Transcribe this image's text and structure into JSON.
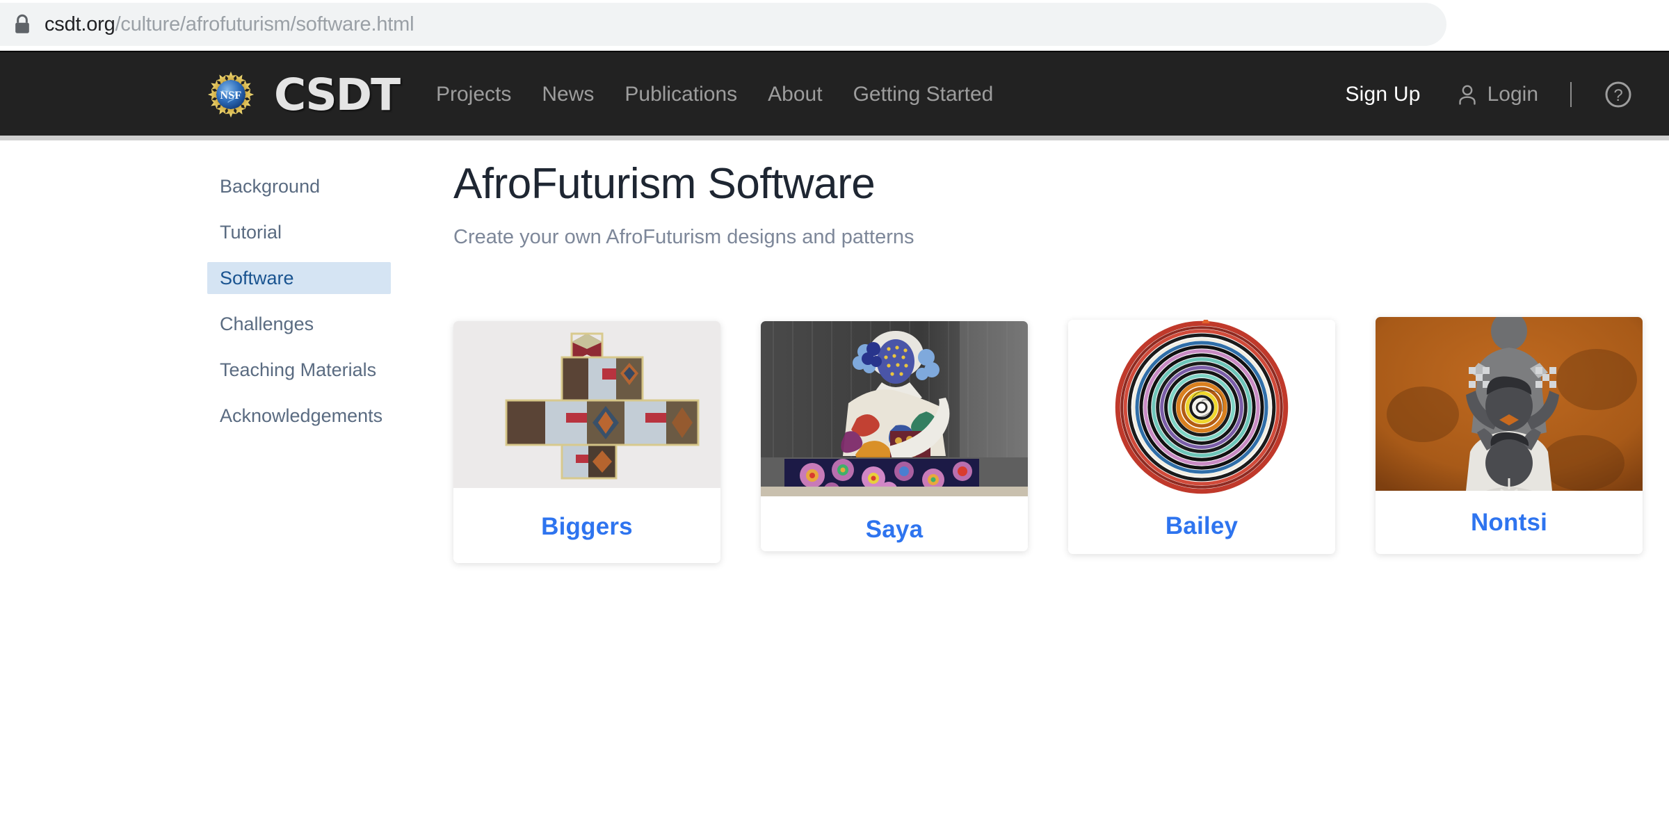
{
  "browser": {
    "lock_icon": "lock-icon",
    "url_domain": "csdt.org",
    "url_path": "/culture/afrofuturism/software.html"
  },
  "navbar": {
    "logo_nsf_text": "NSF",
    "brand_wordmark": "CSDT",
    "links": [
      {
        "label": "Projects"
      },
      {
        "label": "News"
      },
      {
        "label": "Publications"
      },
      {
        "label": "About"
      },
      {
        "label": "Getting Started"
      }
    ],
    "signup_label": "Sign Up",
    "login_label": "Login",
    "help_icon": "help-circle-icon",
    "person_icon": "person-icon",
    "background_color": "#222222",
    "link_color": "#9d9d9d"
  },
  "sidebar": {
    "items": [
      {
        "label": "Background",
        "active": false
      },
      {
        "label": "Tutorial",
        "active": false
      },
      {
        "label": "Software",
        "active": true
      },
      {
        "label": "Challenges",
        "active": false
      },
      {
        "label": "Teaching Materials",
        "active": false
      },
      {
        "label": "Acknowledgements",
        "active": false
      }
    ],
    "active_bg_color": "#d5e4f3",
    "active_text_color": "#1a5490",
    "text_color": "#5a6b81"
  },
  "main": {
    "title": "AfroFuturism Software",
    "subtitle": "Create your own AfroFuturism designs and patterns",
    "title_color": "#1e2632",
    "subtitle_color": "#7d8799"
  },
  "cards": [
    {
      "label": "Biggers",
      "image_name": "biggers-quilt-sculpture-thumbnail",
      "image_description": "Cross-shaped quilted cube sculpture in red, light blue and patterned fabric on a pale gray wall"
    },
    {
      "label": "Saya",
      "image_name": "saya-beaded-figure-thumbnail",
      "image_description": "Beaded figure with blue gold-dotted mask and colorful textiles over a dark rosette-patterned table"
    },
    {
      "label": "Bailey",
      "image_name": "bailey-coiled-basket-thumbnail",
      "image_description": "Circular coiled basket with concentric multicolored spiral rings and a red rim"
    },
    {
      "label": "Nontsi",
      "image_name": "nontsi-hair-braiding-photo-thumbnail",
      "image_description": "Duotone historical photograph of three women braiding hair on a rust orange background"
    }
  ],
  "card_label_color": "#2e74ef"
}
